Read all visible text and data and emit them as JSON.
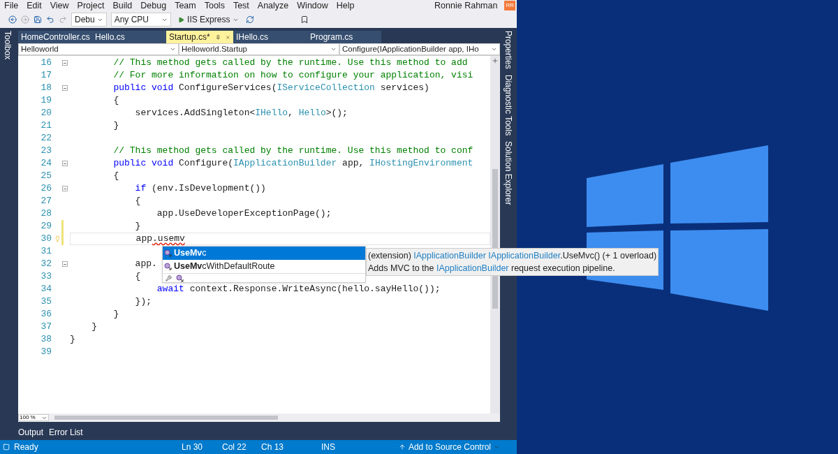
{
  "menu": [
    "File",
    "Edit",
    "View",
    "Project",
    "Build",
    "Debug",
    "Team",
    "Tools",
    "Test",
    "Analyze",
    "Window",
    "Help"
  ],
  "user": {
    "name": "Ronnie Rahman",
    "initials": "RR"
  },
  "toolbar": {
    "configuration": "Debu",
    "platform": "Any CPU",
    "run": "IIS Express"
  },
  "left_panel": "Toolbox",
  "right_panels": [
    "Properties",
    "Diagnostic Tools",
    "Solution Explorer"
  ],
  "tabs": [
    {
      "label": "HomeController.cs",
      "selected": false
    },
    {
      "label": "Hello.cs",
      "selected": false
    },
    {
      "label": "Startup.cs*",
      "selected": true
    },
    {
      "label": "IHello.cs",
      "selected": false
    },
    {
      "label": "Program.cs",
      "selected": false
    }
  ],
  "navigation": [
    "Helloworld",
    "Helloworld.Startup",
    "Configure(IApplicationBuilder app, IHo"
  ],
  "code_lines": [
    {
      "number": "16",
      "fold": true,
      "changed": false,
      "current": false,
      "segments": [
        {
          "kind": "comment",
          "text": "        // This method gets called by the runtime. Use this method to add"
        }
      ]
    },
    {
      "number": "17",
      "fold": false,
      "changed": false,
      "current": false,
      "segments": [
        {
          "kind": "comment",
          "text": "        // For more information on how to configure your application, visi"
        }
      ]
    },
    {
      "number": "18",
      "fold": true,
      "changed": false,
      "current": false,
      "segments": [
        {
          "kind": "keyword",
          "text": "        public void "
        },
        {
          "kind": "plain",
          "text": "ConfigureServices("
        },
        {
          "kind": "type",
          "text": "IServiceCollection"
        },
        {
          "kind": "plain",
          "text": " services)"
        }
      ]
    },
    {
      "number": "19",
      "fold": false,
      "changed": false,
      "current": false,
      "segments": [
        {
          "kind": "plain",
          "text": "        {"
        }
      ]
    },
    {
      "number": "20",
      "fold": false,
      "changed": false,
      "current": false,
      "segments": [
        {
          "kind": "plain",
          "text": "            services.AddSingleton<"
        },
        {
          "kind": "type",
          "text": "IHello"
        },
        {
          "kind": "plain",
          "text": ", "
        },
        {
          "kind": "type",
          "text": "Hello"
        },
        {
          "kind": "plain",
          "text": ">();"
        }
      ]
    },
    {
      "number": "21",
      "fold": false,
      "changed": false,
      "current": false,
      "segments": [
        {
          "kind": "plain",
          "text": "        }"
        }
      ]
    },
    {
      "number": "22",
      "fold": false,
      "changed": false,
      "current": false
    },
    {
      "number": "23",
      "fold": false,
      "changed": false,
      "current": false,
      "segments": [
        {
          "kind": "comment",
          "text": "        // This method gets called by the runtime. Use this method to conf"
        }
      ]
    },
    {
      "number": "24",
      "fold": true,
      "changed": false,
      "current": false,
      "segments": [
        {
          "kind": "keyword",
          "text": "        public void "
        },
        {
          "kind": "plain",
          "text": "Configure("
        },
        {
          "kind": "type",
          "text": "IApplicationBuilder"
        },
        {
          "kind": "plain",
          "text": " app, "
        },
        {
          "kind": "type",
          "text": "IHostingEnvironment"
        }
      ]
    },
    {
      "number": "25",
      "fold": false,
      "changed": false,
      "current": false,
      "segments": [
        {
          "kind": "plain",
          "text": "        {"
        }
      ]
    },
    {
      "number": "26",
      "fold": true,
      "changed": false,
      "current": false,
      "segments": [
        {
          "kind": "keyword",
          "text": "            if"
        },
        {
          "kind": "plain",
          "text": " (env.IsDevelopment())"
        }
      ]
    },
    {
      "number": "27",
      "fold": false,
      "changed": false,
      "current": false,
      "segments": [
        {
          "kind": "plain",
          "text": "            {"
        }
      ]
    },
    {
      "number": "28",
      "fold": false,
      "changed": false,
      "current": false,
      "segments": [
        {
          "kind": "plain",
          "text": "                app.UseDeveloperExceptionPage();"
        }
      ]
    },
    {
      "number": "29",
      "fold": false,
      "changed": true,
      "current": false,
      "segments": [
        {
          "kind": "plain",
          "text": "            }"
        }
      ]
    },
    {
      "number": "30",
      "fold": false,
      "changed": true,
      "current": true,
      "segments": [
        {
          "kind": "plain",
          "text": "            app"
        },
        {
          "kind": "error",
          "text": ".usemv"
        }
      ]
    },
    {
      "number": "31",
      "fold": false,
      "changed": false,
      "current": false
    },
    {
      "number": "32",
      "fold": true,
      "changed": false,
      "current": false,
      "segments": [
        {
          "kind": "plain",
          "text": "            app."
        }
      ]
    },
    {
      "number": "33",
      "fold": false,
      "changed": false,
      "current": false,
      "segments": [
        {
          "kind": "plain",
          "text": "            {"
        }
      ]
    },
    {
      "number": "34",
      "fold": false,
      "changed": false,
      "current": false,
      "segments": [
        {
          "kind": "keyword",
          "text": "                await"
        },
        {
          "kind": "plain",
          "text": " context.Response.WriteAsync(hello.sayHello());"
        }
      ]
    },
    {
      "number": "35",
      "fold": false,
      "changed": false,
      "current": false,
      "segments": [
        {
          "kind": "plain",
          "text": "            });"
        }
      ]
    },
    {
      "number": "36",
      "fold": false,
      "changed": false,
      "current": false,
      "segments": [
        {
          "kind": "plain",
          "text": "        }"
        }
      ]
    },
    {
      "number": "37",
      "fold": false,
      "changed": false,
      "current": false,
      "segments": [
        {
          "kind": "plain",
          "text": "    }"
        }
      ]
    },
    {
      "number": "38",
      "fold": false,
      "changed": false,
      "current": false,
      "segments": [
        {
          "kind": "plain",
          "text": "}"
        }
      ]
    },
    {
      "number": "39",
      "fold": false,
      "changed": false,
      "current": false
    }
  ],
  "completion": {
    "items": [
      {
        "label": "**UseMv**c",
        "selected": true
      },
      {
        "label": "**UseMv**cWithDefaultRoute",
        "selected": false
      }
    ],
    "tooltip": [
      [
        {
          "kind": "plain",
          "text": "(extension) "
        },
        {
          "kind": "type",
          "text": "IApplicationBuilder IApplicationBuilder"
        },
        {
          "kind": "plain",
          "text": ".UseMvc() (+ 1 overload)"
        }
      ],
      [
        {
          "kind": "plain",
          "text": "Adds MVC to the "
        },
        {
          "kind": "type",
          "text": "IApplicationBuilder"
        },
        {
          "kind": "plain",
          "text": " request execution pipeline."
        }
      ]
    ]
  },
  "zoom": "100 %",
  "bottom_tabs": [
    "Output",
    "Error List"
  ],
  "status_bar": {
    "state": "Ready",
    "line": "Ln 30",
    "column": "Col 22",
    "char": "Ch 13",
    "mode": "INS",
    "source_control": "Add to Source Control"
  }
}
